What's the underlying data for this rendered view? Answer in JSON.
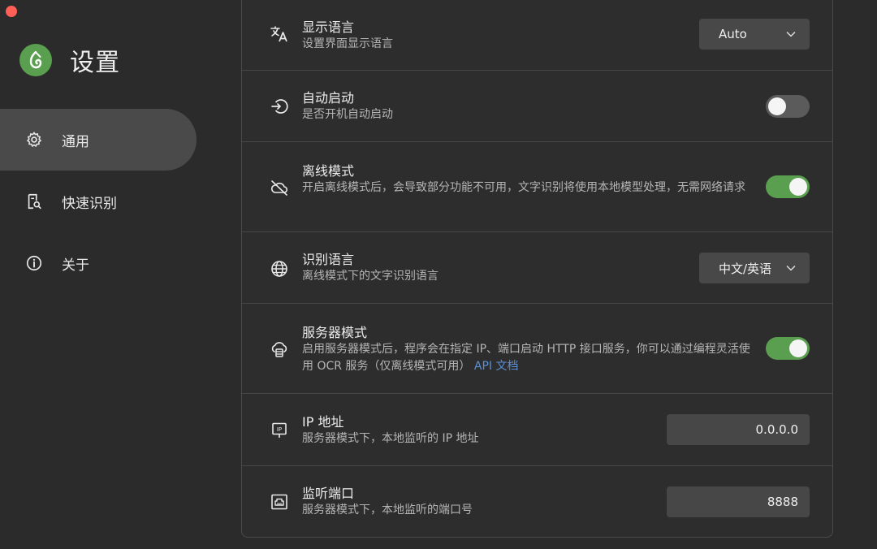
{
  "window": {
    "close_color": "#ff5f57"
  },
  "brand": {
    "title": "设置",
    "logo_color": "#5a9e4f"
  },
  "sidebar": {
    "items": [
      {
        "label": "通用",
        "icon": "gear-icon",
        "active": true
      },
      {
        "label": "快速识别",
        "icon": "document-search-icon",
        "active": false
      },
      {
        "label": "关于",
        "icon": "info-icon",
        "active": false
      }
    ]
  },
  "settings": {
    "display_language": {
      "title": "显示语言",
      "desc": "设置界面显示语言",
      "value": "Auto",
      "icon": "translate-icon"
    },
    "auto_start": {
      "title": "自动启动",
      "desc": "是否开机自动启动",
      "enabled": false,
      "icon": "power-enter-icon"
    },
    "offline_mode": {
      "title": "离线模式",
      "desc": "开启离线模式后，会导致部分功能不可用，文字识别将使用本地模型处理，无需网络请求",
      "enabled": true,
      "icon": "cloud-off-icon"
    },
    "recognition_language": {
      "title": "识别语言",
      "desc": "离线模式下的文字识别语言",
      "value": "中文/英语",
      "icon": "globe-icon"
    },
    "server_mode": {
      "title": "服务器模式",
      "desc": "启用服务器模式后，程序会在指定 IP、端口启动 HTTP 接口服务，你可以通过编程灵活使用 OCR 服务（仅离线模式可用）",
      "link": "API 文档",
      "enabled": true,
      "icon": "cloud-server-icon"
    },
    "ip_address": {
      "title": "IP 地址",
      "desc": "服务器模式下，本地监听的 IP 地址",
      "value": "0.0.0.0",
      "icon": "ip-icon"
    },
    "listen_port": {
      "title": "监听端口",
      "desc": "服务器模式下，本地监听的端口号",
      "value": "8888",
      "icon": "ethernet-port-icon"
    }
  },
  "colors": {
    "accent": "#5a9e4f",
    "link": "#5b8fd6",
    "background": "#2b2b2b"
  }
}
